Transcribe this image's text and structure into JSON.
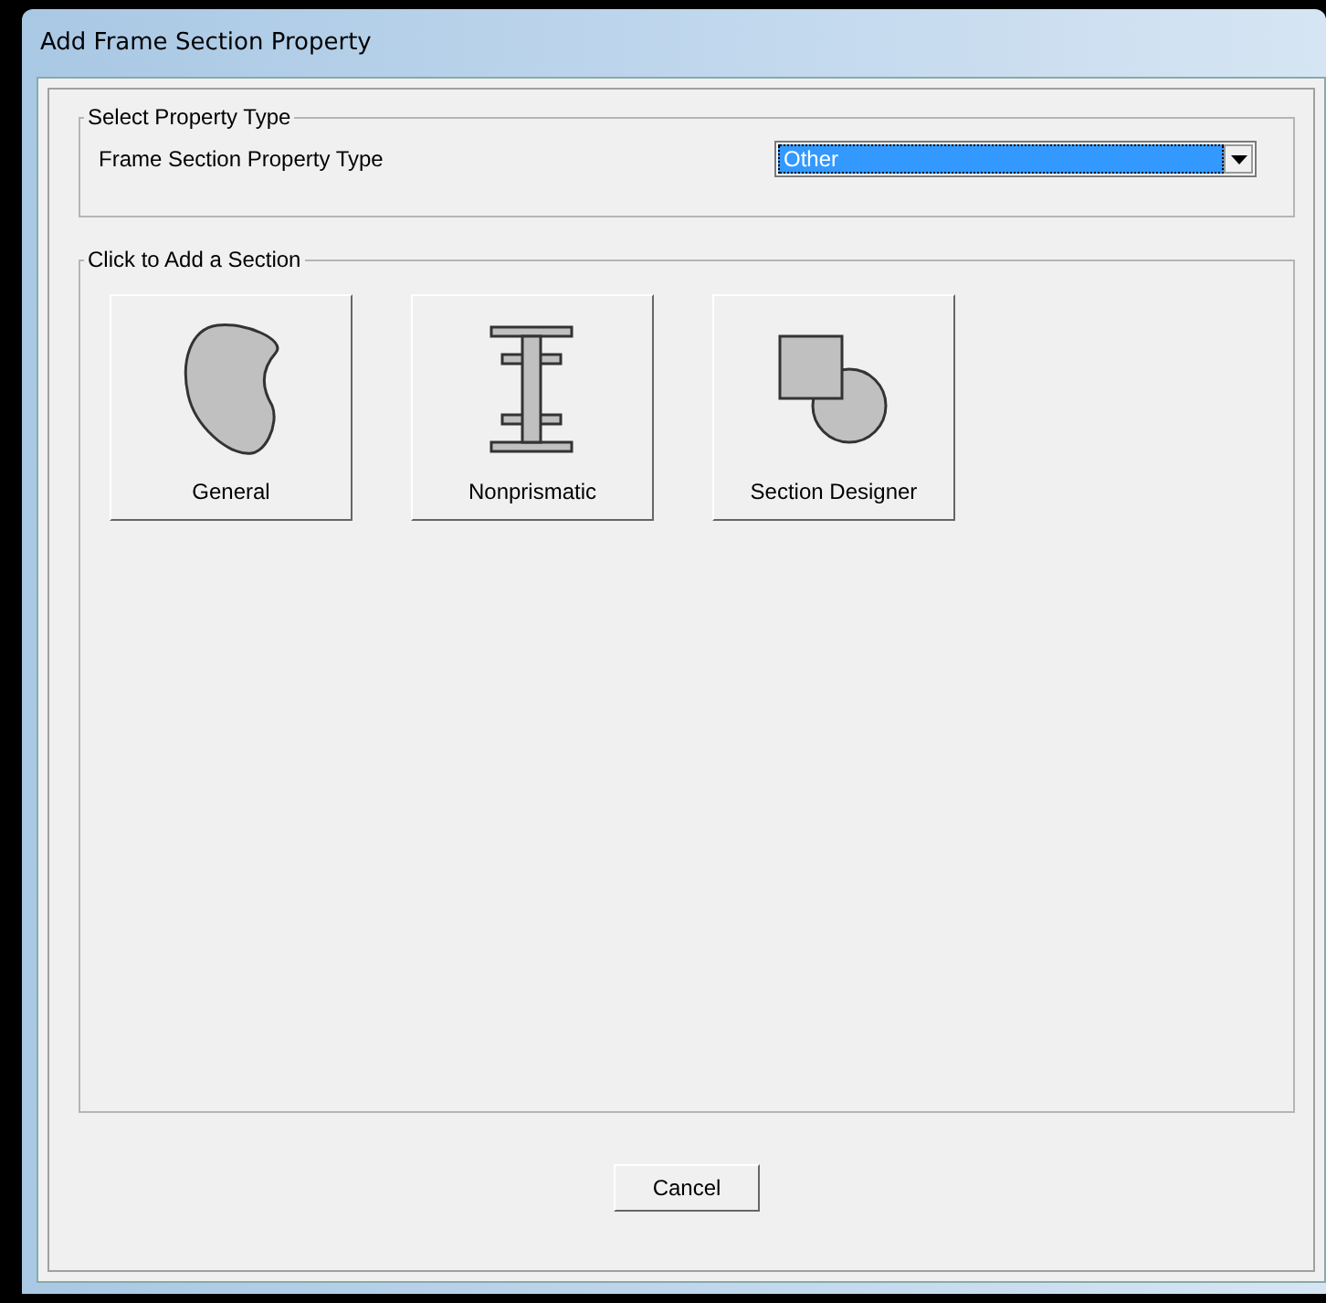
{
  "window": {
    "title": "Add Frame Section Property"
  },
  "property_type_group": {
    "title": "Select Property Type",
    "label": "Frame Section Property Type",
    "dropdown": {
      "value": "Other",
      "focused": true
    }
  },
  "add_section_group": {
    "title": "Click to Add a Section",
    "buttons": [
      {
        "label": "General",
        "kind": "general"
      },
      {
        "label": "Nonprismatic",
        "kind": "nonprismatic"
      },
      {
        "label": "Section Designer",
        "kind": "designer"
      }
    ]
  },
  "buttons": [
    "Cancel"
  ]
}
